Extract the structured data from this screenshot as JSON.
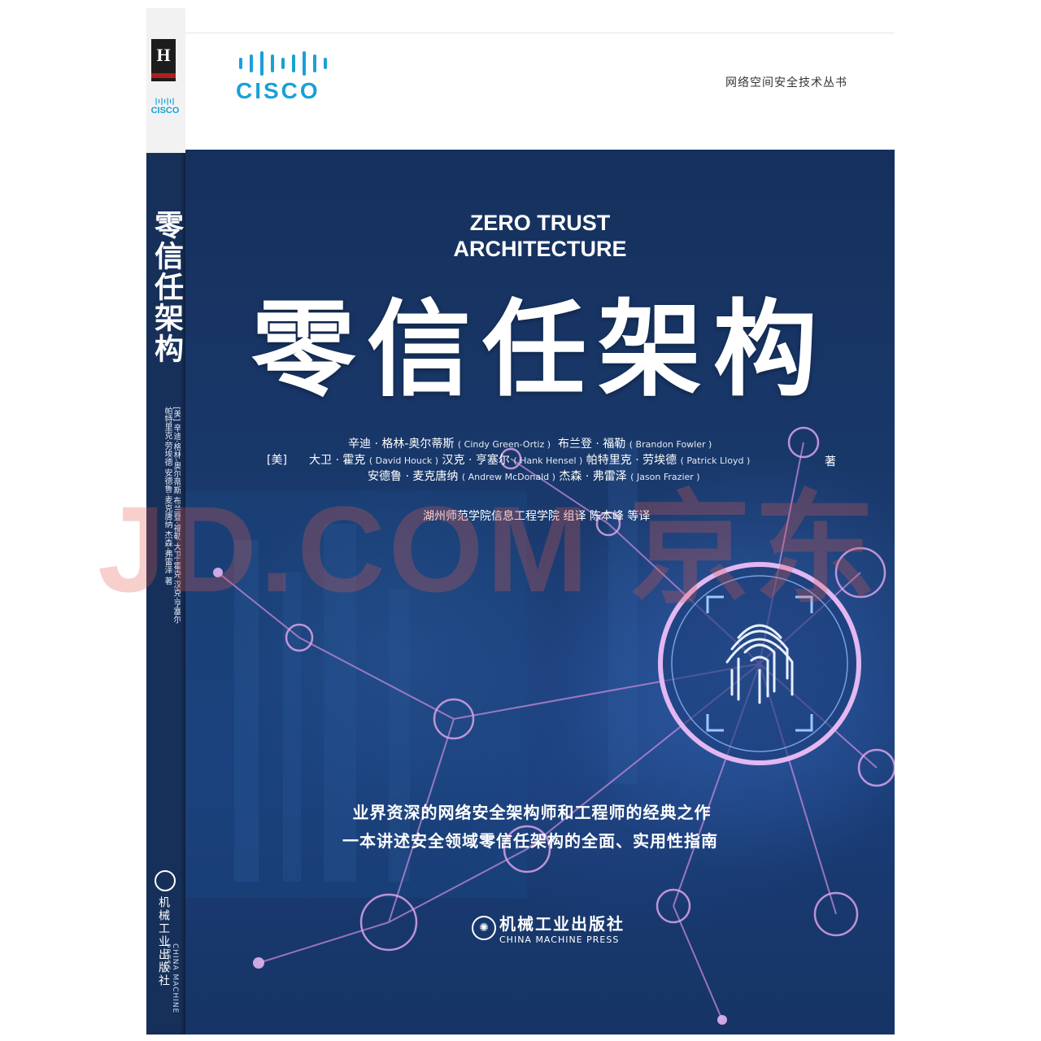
{
  "spine": {
    "title": "零信任架构",
    "authors": "[美] 辛迪·格林-奥尔蒂斯 布兰登·福勒 大卫·霍克 汉克·亨塞尔 帕特里克·劳埃德 安德鲁·麦克唐纳 杰森·弗雷泽 著",
    "publisher": "机械工业出版社",
    "publisher_en": "CHINA MACHINE PRESS",
    "logo_icon": "hzbook-publisher-logo",
    "cisco_text": "CISCO"
  },
  "cover": {
    "brand": "CISCO",
    "series": "网络空间安全技术丛书",
    "title_en_line1": "ZERO TRUST",
    "title_en_line2": "ARCHITECTURE",
    "title_cn": "零信任架构",
    "authors": {
      "prefix": "[美]",
      "suffix": "著",
      "line1_cn": "辛迪 · 格林-奥尔蒂斯",
      "line1_en": "( Cindy Green-Ortiz )",
      "line1b_cn": "布兰登 · 福勒",
      "line1b_en": "( Brandon Fowler )",
      "line2_cn": "大卫 · 霍克",
      "line2_en": "( David Houck )",
      "line2b_cn": "汉克 · 亨塞尔",
      "line2b_en": "( Hank Hensel )",
      "line2c_cn": "帕特里克 · 劳埃德",
      "line2c_en": "( Patrick Lloyd )",
      "line3_cn": "安德鲁 · 麦克唐纳",
      "line3_en": "( Andrew McDonald )",
      "line3b_cn": "杰森 · 弗雷泽",
      "line3b_en": "( Jason Frazier )"
    },
    "translator": "湖州师范学院信息工程学院 组译  陈本峰 等译",
    "slogan1": "业界资深的网络安全架构师和工程师的经典之作",
    "slogan2": "一本讲述安全领域零信任架构的全面、实用性指南",
    "publisher_cn": "机械工业出版社",
    "publisher_en": "CHINA MACHINE PRESS",
    "art_icon": "fingerprint-network-icon",
    "accent": "#1aa0d8",
    "background": "#16305c"
  },
  "watermark": "JD.COM 京东"
}
